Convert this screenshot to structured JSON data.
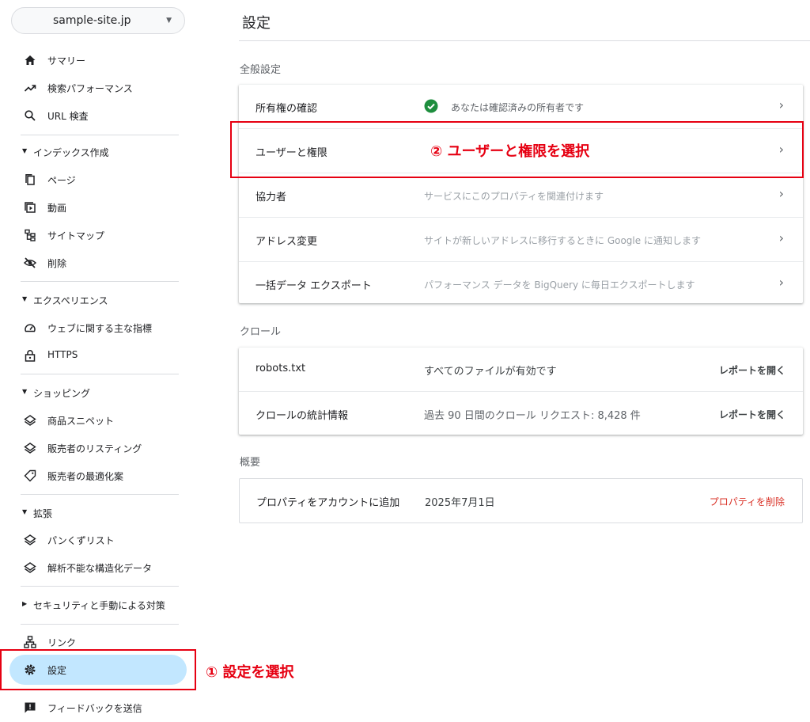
{
  "property": {
    "name": "sample-site.jp"
  },
  "sidebar": {
    "items": {
      "summary": "サマリー",
      "performance": "検索パフォーマンス",
      "url_inspection": "URL 検査",
      "pages": "ページ",
      "video": "動画",
      "sitemaps": "サイトマップ",
      "removals": "削除",
      "web_vitals": "ウェブに関する主な指標",
      "https": "HTTPS",
      "product_snippets": "商品スニペット",
      "merchant_listings": "販売者のリスティング",
      "merchant_opportunities": "販売者の最適化案",
      "breadcrumbs": "パンくずリスト",
      "unparsable": "解析不能な構造化データ",
      "links": "リンク",
      "settings": "設定",
      "feedback": "フィードバックを送信"
    },
    "sections": {
      "indexing": "インデックス作成",
      "experience": "エクスペリエンス",
      "shopping": "ショッピング",
      "enhancements": "拡張",
      "security": "セキュリティと手動による対策"
    }
  },
  "annotations": {
    "step1": "① 設定を選択",
    "step2": "② ユーザーと権限を選択",
    "color": "#e60012"
  },
  "main": {
    "title": "設定",
    "general": {
      "label": "全般設定",
      "rows": [
        {
          "label": "所有権の確認",
          "desc": "あなたは確認済みの所有者です"
        },
        {
          "label": "ユーザーと権限",
          "desc": ""
        },
        {
          "label": "協力者",
          "desc": "サービスにこのプロパティを関連付けます"
        },
        {
          "label": "アドレス変更",
          "desc": "サイトが新しいアドレスに移行するときに Google に通知します"
        },
        {
          "label": "一括データ エクスポート",
          "desc": "パフォーマンス データを BigQuery に毎日エクスポートします"
        }
      ]
    },
    "crawl": {
      "label": "クロール",
      "rows": [
        {
          "label": "robots.txt",
          "desc": "すべてのファイルが有効です",
          "action": "レポートを開く"
        },
        {
          "label": "クロールの統計情報",
          "desc": "過去 90 日間のクロール リクエスト: 8,428 件",
          "action": "レポートを開く"
        }
      ]
    },
    "about": {
      "label": "概要",
      "rows": [
        {
          "label": "プロパティをアカウントに追加",
          "desc": "2025年7月1日",
          "action": "プロパティを削除"
        }
      ]
    }
  }
}
